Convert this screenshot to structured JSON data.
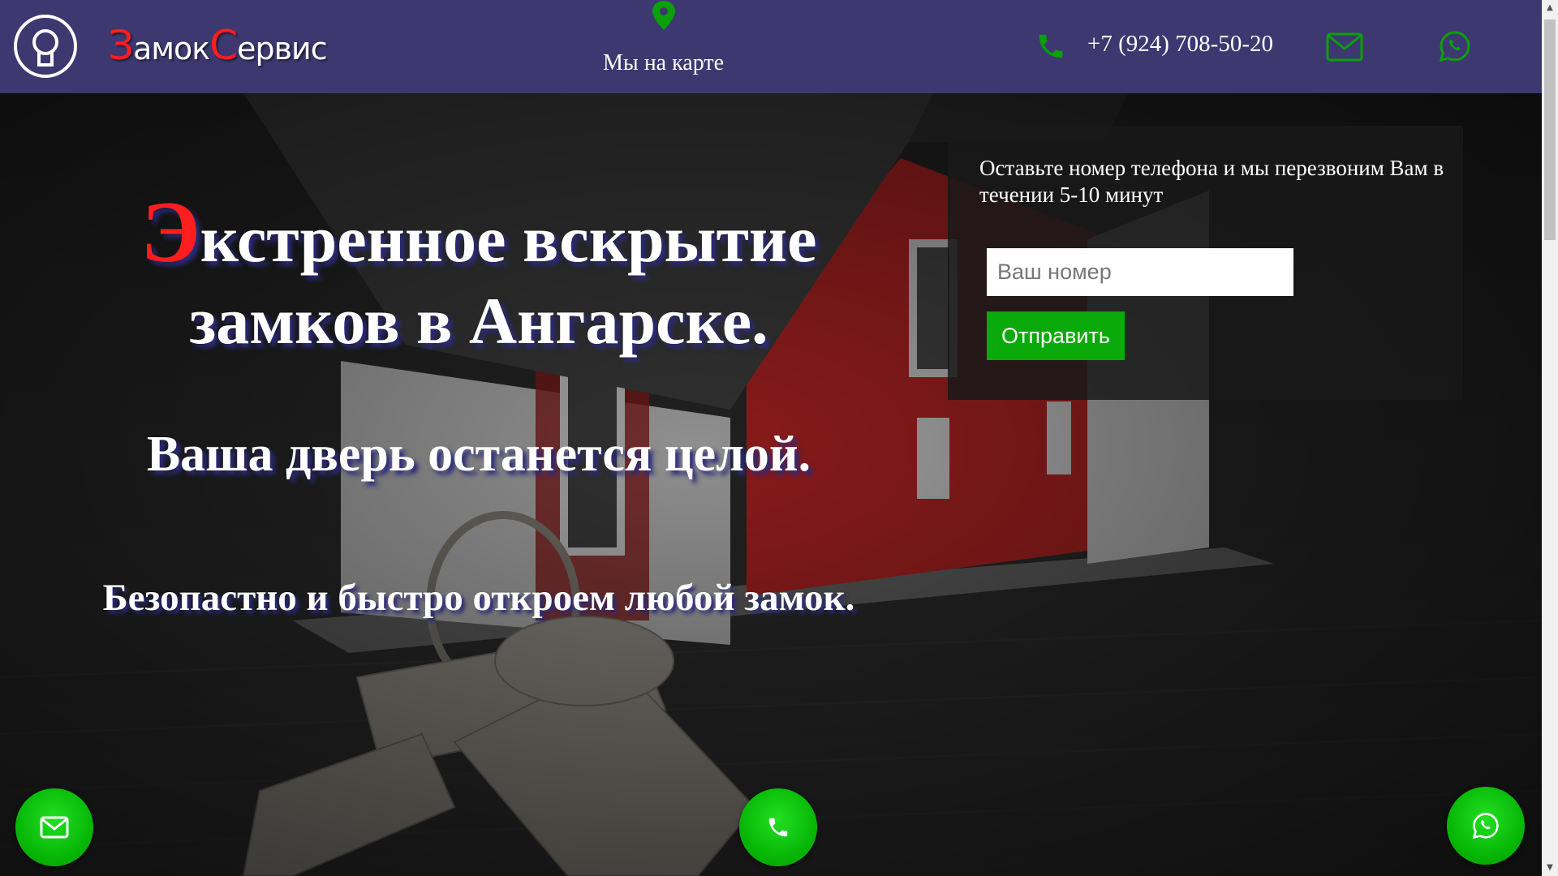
{
  "header": {
    "brand_first_cap": "З",
    "brand_part1": "амок",
    "brand_second_cap": "С",
    "brand_part2": "ервис",
    "map_label": "Мы на карте",
    "phone": "+7 (924) 708-50-20"
  },
  "hero": {
    "title_cap": "Э",
    "title_rest": "кстренное вскрытие замков в Ангарске.",
    "subtitle": "Ваша дверь останется целой.",
    "tagline": "Безопастно и быстро откроем любой замок."
  },
  "form": {
    "text": "Оставьте номер телефона и мы перезвоним Вам в течении 5-10 минут",
    "placeholder": "Ваш номер",
    "submit_label": "Отправить"
  },
  "icons": {
    "logo": "keyhole-icon",
    "map": "map-pin-icon",
    "phone": "phone-icon",
    "mail": "mail-icon",
    "whatsapp": "whatsapp-icon"
  },
  "colors": {
    "header_bg": "#3d3870",
    "accent_green": "#09aa09",
    "accent_red": "#ff1e1e"
  }
}
